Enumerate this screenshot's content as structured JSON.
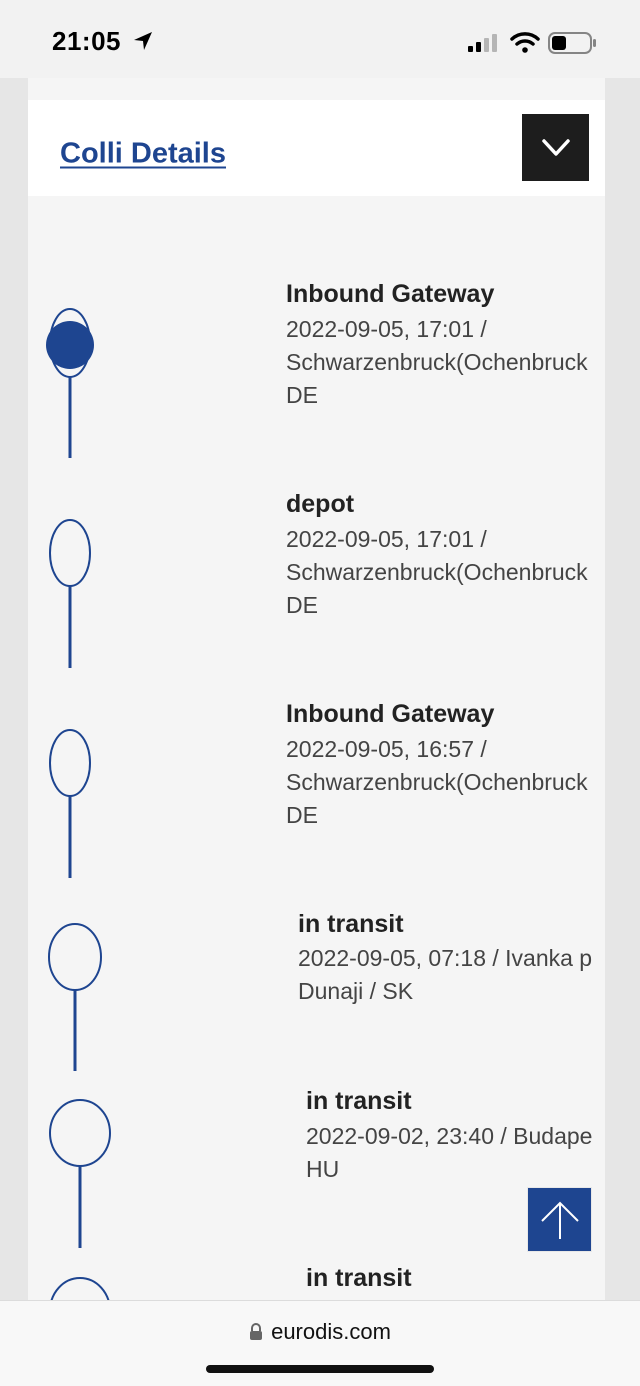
{
  "status_bar": {
    "time": "21:05"
  },
  "colli": {
    "link_label": "Colli Details"
  },
  "events": [
    {
      "title": "Inbound Gateway",
      "meta": "2022-09-05, 17:01 /\nSchwarzenbruck(Ochenbruck\nDE",
      "active": true
    },
    {
      "title": "depot",
      "meta": "2022-09-05, 17:01 /\nSchwarzenbruck(Ochenbruck\nDE",
      "active": false
    },
    {
      "title": "Inbound Gateway",
      "meta": "2022-09-05, 16:57 /\nSchwarzenbruck(Ochenbruck\nDE",
      "active": false
    },
    {
      "title": "in transit",
      "meta": "2022-09-05, 07:18 / Ivanka p\nDunaji / SK",
      "active": false
    },
    {
      "title": "in transit",
      "meta": "2022-09-02, 23:40 / Budape\nHU",
      "active": false
    },
    {
      "title": "in transit",
      "meta": "",
      "active": false
    }
  ],
  "browser": {
    "url": "eurodis.com"
  },
  "colors": {
    "accent": "#1e4590",
    "dark": "#1d1d1d"
  }
}
